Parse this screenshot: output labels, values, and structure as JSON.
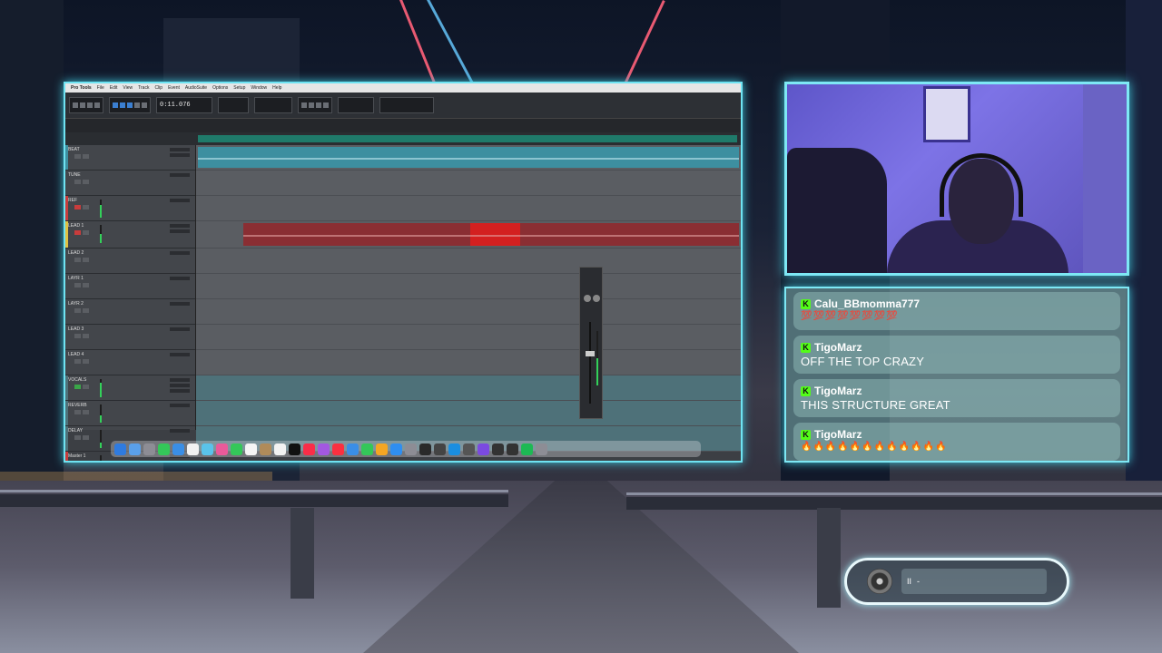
{
  "daw": {
    "app_name": "Pro Tools",
    "menu": [
      "File",
      "Edit",
      "View",
      "Track",
      "Clip",
      "Event",
      "AudioSuite",
      "Options",
      "Setup",
      "Window",
      "Help"
    ],
    "counter": "0:11.076",
    "tracks": [
      {
        "name": "BEAT",
        "color": "#3d8fa0"
      },
      {
        "name": "TUNE",
        "color": "#5a5d62"
      },
      {
        "name": "REF",
        "color": "#c83c3c"
      },
      {
        "name": "LEAD 1",
        "color": "#e0c040"
      },
      {
        "name": "LEAD 2",
        "color": "#5a5d62"
      },
      {
        "name": "LAYR 1",
        "color": "#5a5d62"
      },
      {
        "name": "LAYR 2",
        "color": "#5a5d62"
      },
      {
        "name": "LEAD 3",
        "color": "#5a5d62"
      },
      {
        "name": "LEAD 4",
        "color": "#5a5d62"
      },
      {
        "name": "VOCALS",
        "color": "#4e7179"
      },
      {
        "name": "REVERB",
        "color": "#4e7179"
      },
      {
        "name": "DELAY",
        "color": "#4e7179"
      },
      {
        "name": "Master 1",
        "color": "#c83c3c"
      }
    ]
  },
  "chat": {
    "messages": [
      {
        "user": "Calu_BBmomma777",
        "text": "💯💯💯💯💯💯💯💯",
        "kind": "hundred"
      },
      {
        "user": "TigoMarz",
        "text": "OFF THE TOP CRAZY",
        "kind": "text"
      },
      {
        "user": "TigoMarz",
        "text": "THIS STRUCTURE GREAT",
        "kind": "text"
      },
      {
        "user": "TigoMarz",
        "text": "🔥🔥🔥🔥🔥🔥🔥🔥🔥🔥🔥🔥",
        "kind": "emoji"
      }
    ],
    "badge_letter": "K"
  },
  "player": {
    "pause_glyph": "II",
    "dash": "-"
  },
  "icons": {
    "disc": "vinyl-disc-icon",
    "badge": "kick-badge-icon"
  }
}
